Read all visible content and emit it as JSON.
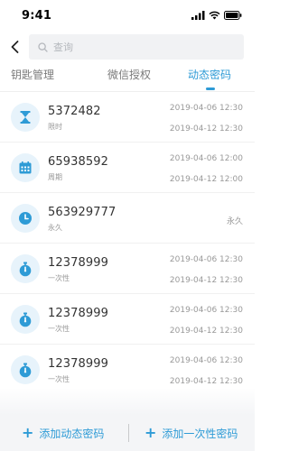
{
  "status_bar": {
    "time": "9:41"
  },
  "search": {
    "placeholder": "查询"
  },
  "tabs": [
    {
      "label": "钥匙管理",
      "active": false
    },
    {
      "label": "微信授权",
      "active": false
    },
    {
      "label": "动态密码",
      "active": true
    }
  ],
  "accent_color": "#2e9bd6",
  "passwords": [
    {
      "code": "5372482",
      "type": "限时",
      "icon": "hourglass-icon",
      "start": "2019-04-06 12:30",
      "end": "2019-04-12 12:30"
    },
    {
      "code": "65938592",
      "type": "周期",
      "icon": "calendar-icon",
      "start": "2019-04-06 12:00",
      "end": "2019-04-12 12:00"
    },
    {
      "code": "563929777",
      "type": "永久",
      "icon": "clock-icon",
      "validity": "永久"
    },
    {
      "code": "12378999",
      "type": "一次性",
      "icon": "stopwatch-icon",
      "start": "2019-04-06 12:30",
      "end": "2019-04-12 12:30"
    },
    {
      "code": "12378999",
      "type": "一次性",
      "icon": "stopwatch-icon",
      "start": "2019-04-06 12:30",
      "end": "2019-04-12 12:30"
    },
    {
      "code": "12378999",
      "type": "一次性",
      "icon": "stopwatch-icon",
      "start": "2019-04-06 12:30",
      "end": "2019-04-12 12:30"
    }
  ],
  "bottom": {
    "add_dynamic": "添加动态密码",
    "add_once": "添加一次性密码"
  }
}
